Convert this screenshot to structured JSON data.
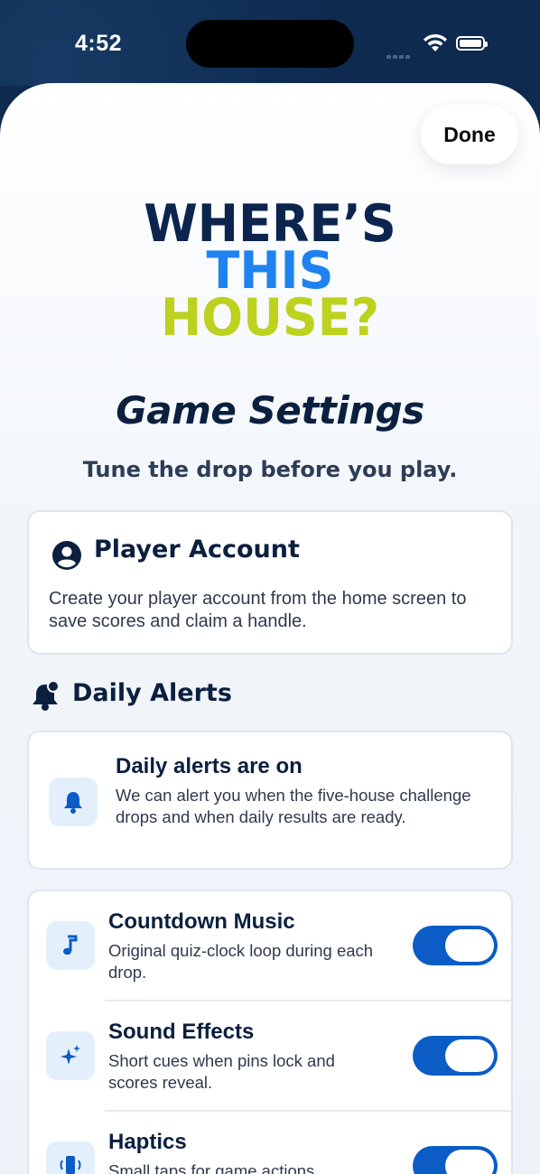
{
  "status_bar": {
    "time": "4:52"
  },
  "header": {
    "done_label": "Done"
  },
  "logo": {
    "line1": "WHERE’S",
    "line2": "THIS",
    "line3": "HOUSE?"
  },
  "page": {
    "title": "Game Settings",
    "subtitle": "Tune the drop before you play."
  },
  "account": {
    "icon": "person-circle-icon",
    "title": "Player Account",
    "body": "Create your player account from the home screen to save scores and claim a handle."
  },
  "alerts_section": {
    "icon": "bell-badge-icon",
    "label": "Daily Alerts",
    "status_title": "Daily alerts are on",
    "status_body": "We can alert you when the five-house challenge drops and when daily results are ready."
  },
  "toggles": [
    {
      "icon": "music-note-icon",
      "title": "Countdown Music",
      "desc": "Original quiz-clock loop during each drop.",
      "on": true
    },
    {
      "icon": "sparkles-icon",
      "title": "Sound Effects",
      "desc": "Short cues when pins lock and scores reveal.",
      "on": true
    },
    {
      "icon": "phone-vibrate-icon",
      "title": "Haptics",
      "desc": "Small taps for game actions",
      "on": true
    }
  ],
  "colors": {
    "navy": "#0b254e",
    "blue": "#1e83f0",
    "lime": "#bcd21f",
    "toggle_on": "#0b5cc5"
  }
}
